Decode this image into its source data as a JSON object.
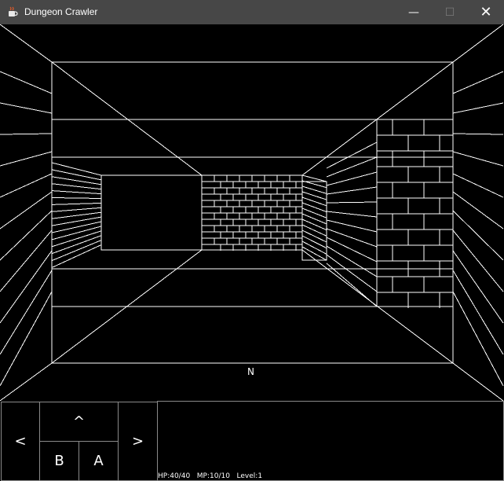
{
  "window": {
    "title": "Dungeon Crawler",
    "minimize_glyph": "—",
    "maximize_glyph": "☐",
    "close_glyph": "✕",
    "icon": "java-cup-icon"
  },
  "view": {
    "compass_heading": "N",
    "line_color": "#ffffff",
    "background_color": "#000000",
    "wall_texture": "brick"
  },
  "controls": {
    "turn_left": "<",
    "forward": "^",
    "turn_right": ">",
    "b_button": "B",
    "a_button": "A"
  },
  "status": {
    "hp": "HP:40/40",
    "mp": "MP:10/10",
    "level": "Level:1"
  }
}
